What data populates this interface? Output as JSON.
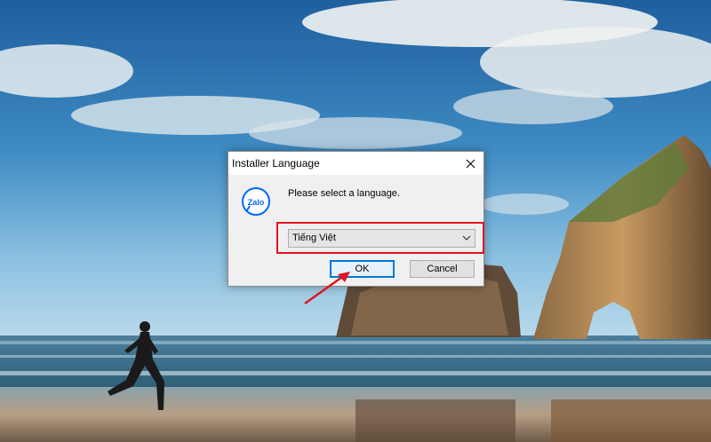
{
  "dialog": {
    "title": "Installer Language",
    "close_icon": "close-icon",
    "app_icon": "zalo-logo",
    "logo_text": "Zalo",
    "prompt": "Please select a language.",
    "language_select": {
      "selected": "Tiếng Việt",
      "icon": "chevron-down-icon"
    },
    "ok_label": "OK",
    "cancel_label": "Cancel"
  },
  "annotations": {
    "highlight_color": "#e0141f",
    "arrow_color": "#e0141f"
  }
}
